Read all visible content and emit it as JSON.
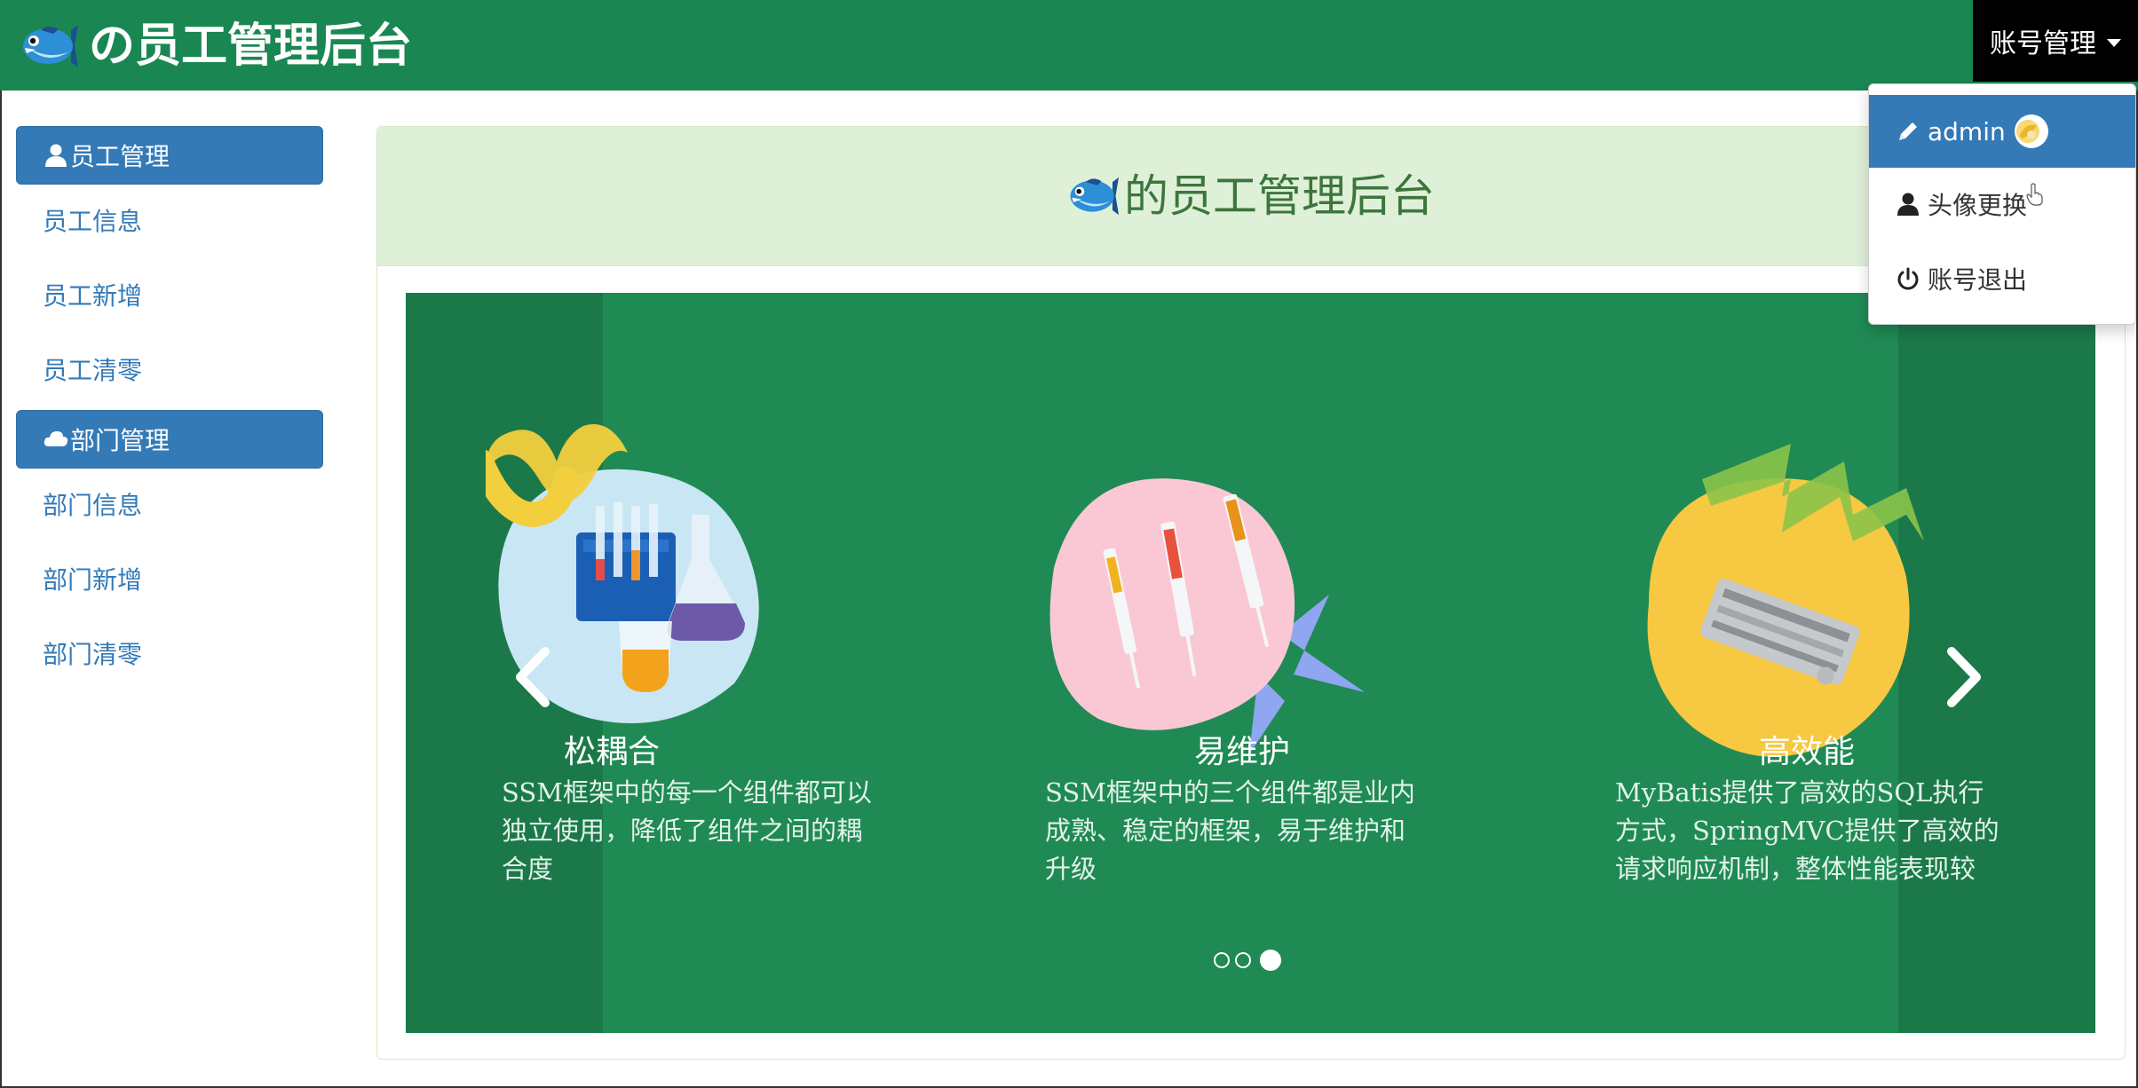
{
  "header": {
    "brand_text": "の员工管理后台",
    "account_menu_label": "账号管理"
  },
  "sidebar": {
    "groups": [
      {
        "title": "员工管理",
        "icon": "user-icon",
        "links": [
          "员工信息",
          "员工新增",
          "员工清零"
        ]
      },
      {
        "title": "部门管理",
        "icon": "cloud-icon",
        "links": [
          "部门信息",
          "部门新增",
          "部门清零"
        ]
      }
    ]
  },
  "main": {
    "panel_title": "的员工管理后台"
  },
  "carousel": {
    "active_index": 2,
    "slide_count": 3,
    "features": [
      {
        "title": "松耦合",
        "desc_lines": [
          "SSM框架中的每一个组件都可以",
          "独立使用，降低了组件之间的耦",
          "合度"
        ]
      },
      {
        "title": "易维护",
        "desc_lines": [
          "SSM框架中的三个组件都是业内",
          "成熟、稳定的框架，易于维护和",
          "升级"
        ]
      },
      {
        "title": "高效能",
        "desc_lines": [
          "MyBatis提供了高效的SQL执行",
          "方式，SpringMVC提供了高效的",
          "请求响应机制，整体性能表现较"
        ]
      }
    ],
    "colors": {
      "background": "#1f8a54",
      "blob_blue": "#c9e6f5",
      "blob_pink": "#fac8d4",
      "blob_yellow": "#f7c842"
    }
  },
  "dropdown": {
    "items": [
      {
        "label": "admin",
        "icon": "pencil-icon",
        "active": true
      },
      {
        "label": "头像更换",
        "icon": "user-icon",
        "active": false
      },
      {
        "label": "账号退出",
        "icon": "power-icon",
        "active": false
      }
    ]
  },
  "colors": {
    "header_bg": "#1a8753",
    "primary": "#337ab7",
    "panel_head_bg": "#dff0d8",
    "panel_title": "#3c763d"
  }
}
